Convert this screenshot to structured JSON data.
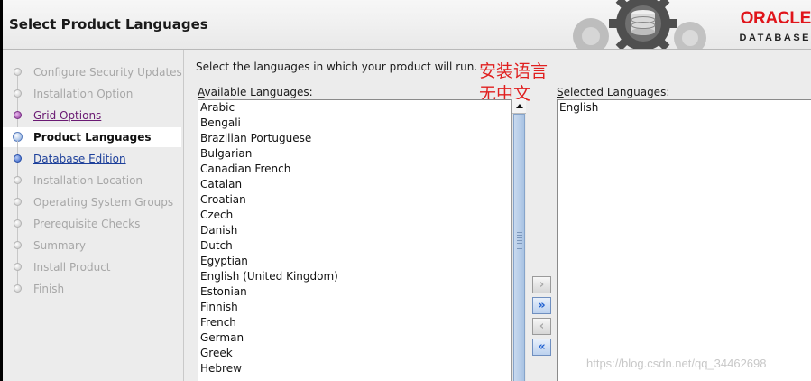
{
  "window": {
    "title": "Select Product Languages"
  },
  "logo": {
    "brand": "ORACLE",
    "product": "DATABASE"
  },
  "sidebar": {
    "steps": [
      {
        "label": "Configure Security Updates",
        "state": "disabled"
      },
      {
        "label": "Installation Option",
        "state": "disabled"
      },
      {
        "label": "Grid Options",
        "state": "link"
      },
      {
        "label": "Product Languages",
        "state": "current"
      },
      {
        "label": "Database Edition",
        "state": "link"
      },
      {
        "label": "Installation Location",
        "state": "disabled"
      },
      {
        "label": "Operating System Groups",
        "state": "disabled"
      },
      {
        "label": "Prerequisite Checks",
        "state": "disabled"
      },
      {
        "label": "Summary",
        "state": "disabled"
      },
      {
        "label": "Install Product",
        "state": "disabled"
      },
      {
        "label": "Finish",
        "state": "disabled"
      }
    ]
  },
  "main": {
    "instruction": "Select the languages in which your product will run.",
    "available_label_mnemonic": "A",
    "available_label_rest": "vailable Languages:",
    "selected_label_mnemonic": "S",
    "selected_label_rest": "elected Languages:",
    "annotation_line1": "安装语言",
    "annotation_line2": "无中文",
    "available_languages": [
      "Arabic",
      "Bengali",
      "Brazilian Portuguese",
      "Bulgarian",
      "Canadian French",
      "Catalan",
      "Croatian",
      "Czech",
      "Danish",
      "Dutch",
      "Egyptian",
      "English (United Kingdom)",
      "Estonian",
      "Finnish",
      "French",
      "German",
      "Greek",
      "Hebrew"
    ],
    "selected_languages": [
      "English"
    ],
    "buttons": {
      "add": "›",
      "add_all": "»",
      "remove": "‹",
      "remove_all": "«"
    }
  },
  "watermark": "https://blog.csdn.net/qq_34462698",
  "colors": {
    "accent_red": "#e0151b",
    "annotation_red": "#e02020",
    "link_purple": "#6a1a73",
    "link_blue": "#1c3f9a"
  }
}
